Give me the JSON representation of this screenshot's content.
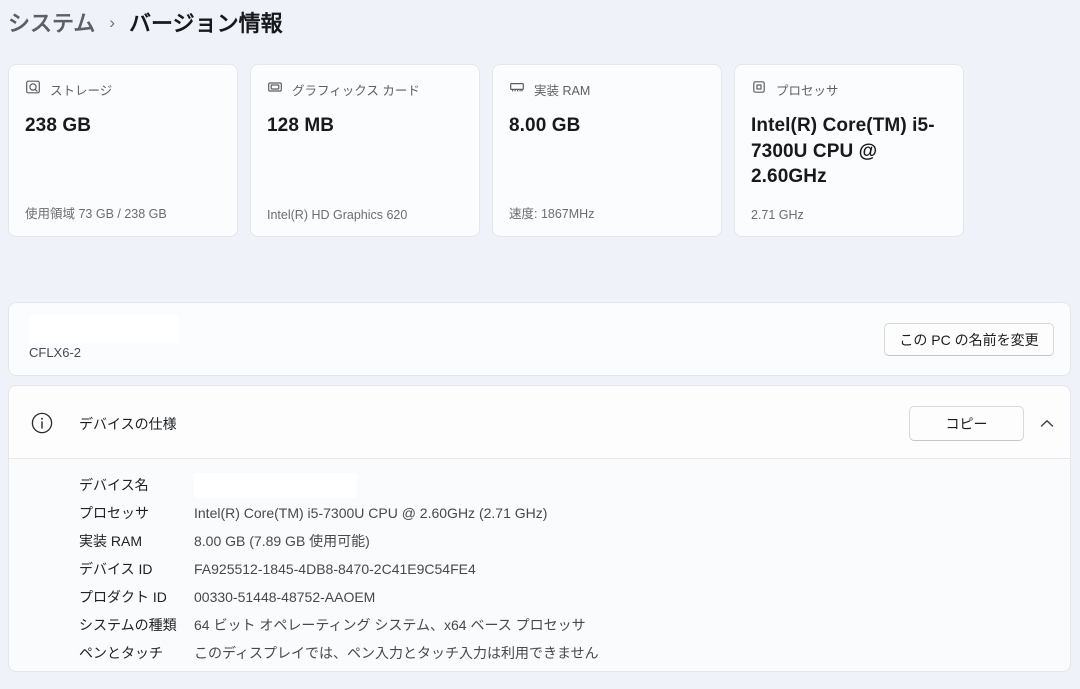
{
  "breadcrumb": {
    "parent": "システム",
    "separator": "›",
    "current": "バージョン情報"
  },
  "cards": [
    {
      "icon": "storage-icon",
      "label": "ストレージ",
      "value": "238 GB",
      "detail": "使用領域 73 GB / 238 GB"
    },
    {
      "icon": "gpu-icon",
      "label": "グラフィックス カード",
      "value": "128 MB",
      "detail": "Intel(R) HD Graphics 620"
    },
    {
      "icon": "ram-icon",
      "label": "実装 RAM",
      "value": "8.00 GB",
      "detail": "速度: 1867MHz"
    },
    {
      "icon": "cpu-icon",
      "label": "プロセッサ",
      "value": "Intel(R) Core(TM) i5-7300U CPU @ 2.60GHz",
      "detail": "2.71 GHz"
    }
  ],
  "pc_name": {
    "name": "CFLX6-2",
    "name_redacted": true,
    "rename_button_label": "この PC の名前を変更"
  },
  "device_spec": {
    "title": "デバイスの仕様",
    "copy_button_label": "コピー",
    "expanded": true,
    "rows": [
      {
        "label": "デバイス名",
        "value": "",
        "redacted": true
      },
      {
        "label": "プロセッサ",
        "value": "Intel(R) Core(TM) i5-7300U CPU @ 2.60GHz (2.71 GHz)",
        "redacted": false
      },
      {
        "label": "実装 RAM",
        "value": "8.00 GB (7.89 GB 使用可能)",
        "redacted": false
      },
      {
        "label": "デバイス ID",
        "value": "FA925512-1845-4DB8-8470-2C41E9C54FE4",
        "redacted": false
      },
      {
        "label": "プロダクト ID",
        "value": "00330-51448-48752-AAOEM",
        "redacted": false
      },
      {
        "label": "システムの種類",
        "value": "64 ビット オペレーティング システム、x64 ベース プロセッサ",
        "redacted": false
      },
      {
        "label": "ペンとタッチ",
        "value": "このディスプレイでは、ペン入力とタッチ入力は利用できません",
        "redacted": false
      }
    ]
  }
}
